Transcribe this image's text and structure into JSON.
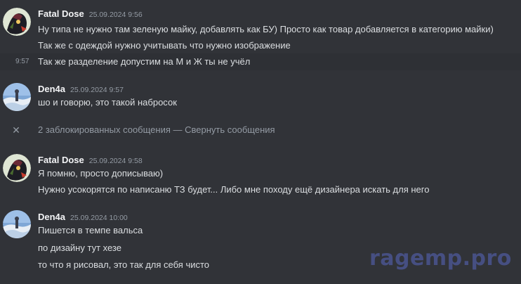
{
  "colors": {
    "background": "#313338",
    "hover_background": "#2e3035",
    "author_name": "#f2f3f5",
    "message_text": "#dbdee1",
    "muted_text": "#949ba4",
    "watermark": "#4a5590"
  },
  "messages": [
    {
      "author": "Fatal Dose",
      "timestamp": "25.09.2024 9:56",
      "avatar_icon": "avatar-fatal-dose-icon",
      "lines": [
        "Ну типа не нужно там зеленую майку, добавлять как БУ) Просто как товар добавляется в категорию майки)",
        "Так же с одеждой нужно учитывать что нужно изображение",
        "Так же разделение допустим на М и Ж ты не учёл"
      ],
      "hover_time": "9:57"
    },
    {
      "author": "Den4a",
      "timestamp": "25.09.2024 9:57",
      "avatar_icon": "avatar-den4a-icon",
      "lines": [
        "шо и говорю, это такой набросок"
      ]
    },
    {
      "author": "Fatal Dose",
      "timestamp": "25.09.2024 9:58",
      "avatar_icon": "avatar-fatal-dose-icon",
      "lines": [
        "Я помню, просто дописываю)",
        "Нужно усокорятся по написаню ТЗ будет... Либо мне походу ещё дизайнера искать для него"
      ]
    },
    {
      "author": "Den4a",
      "timestamp": "25.09.2024 10:00",
      "avatar_icon": "avatar-den4a-icon",
      "lines": [
        "Пишется в темпе вальса",
        "по дизайну тут хезе",
        "то что я рисовал, это так для себя чисто"
      ]
    }
  ],
  "blocked": {
    "text": "2 заблокированных сообщения",
    "separator": " — ",
    "link": "Свернуть сообщения",
    "icon": "close-icon"
  },
  "watermark": "ragemp.pro"
}
